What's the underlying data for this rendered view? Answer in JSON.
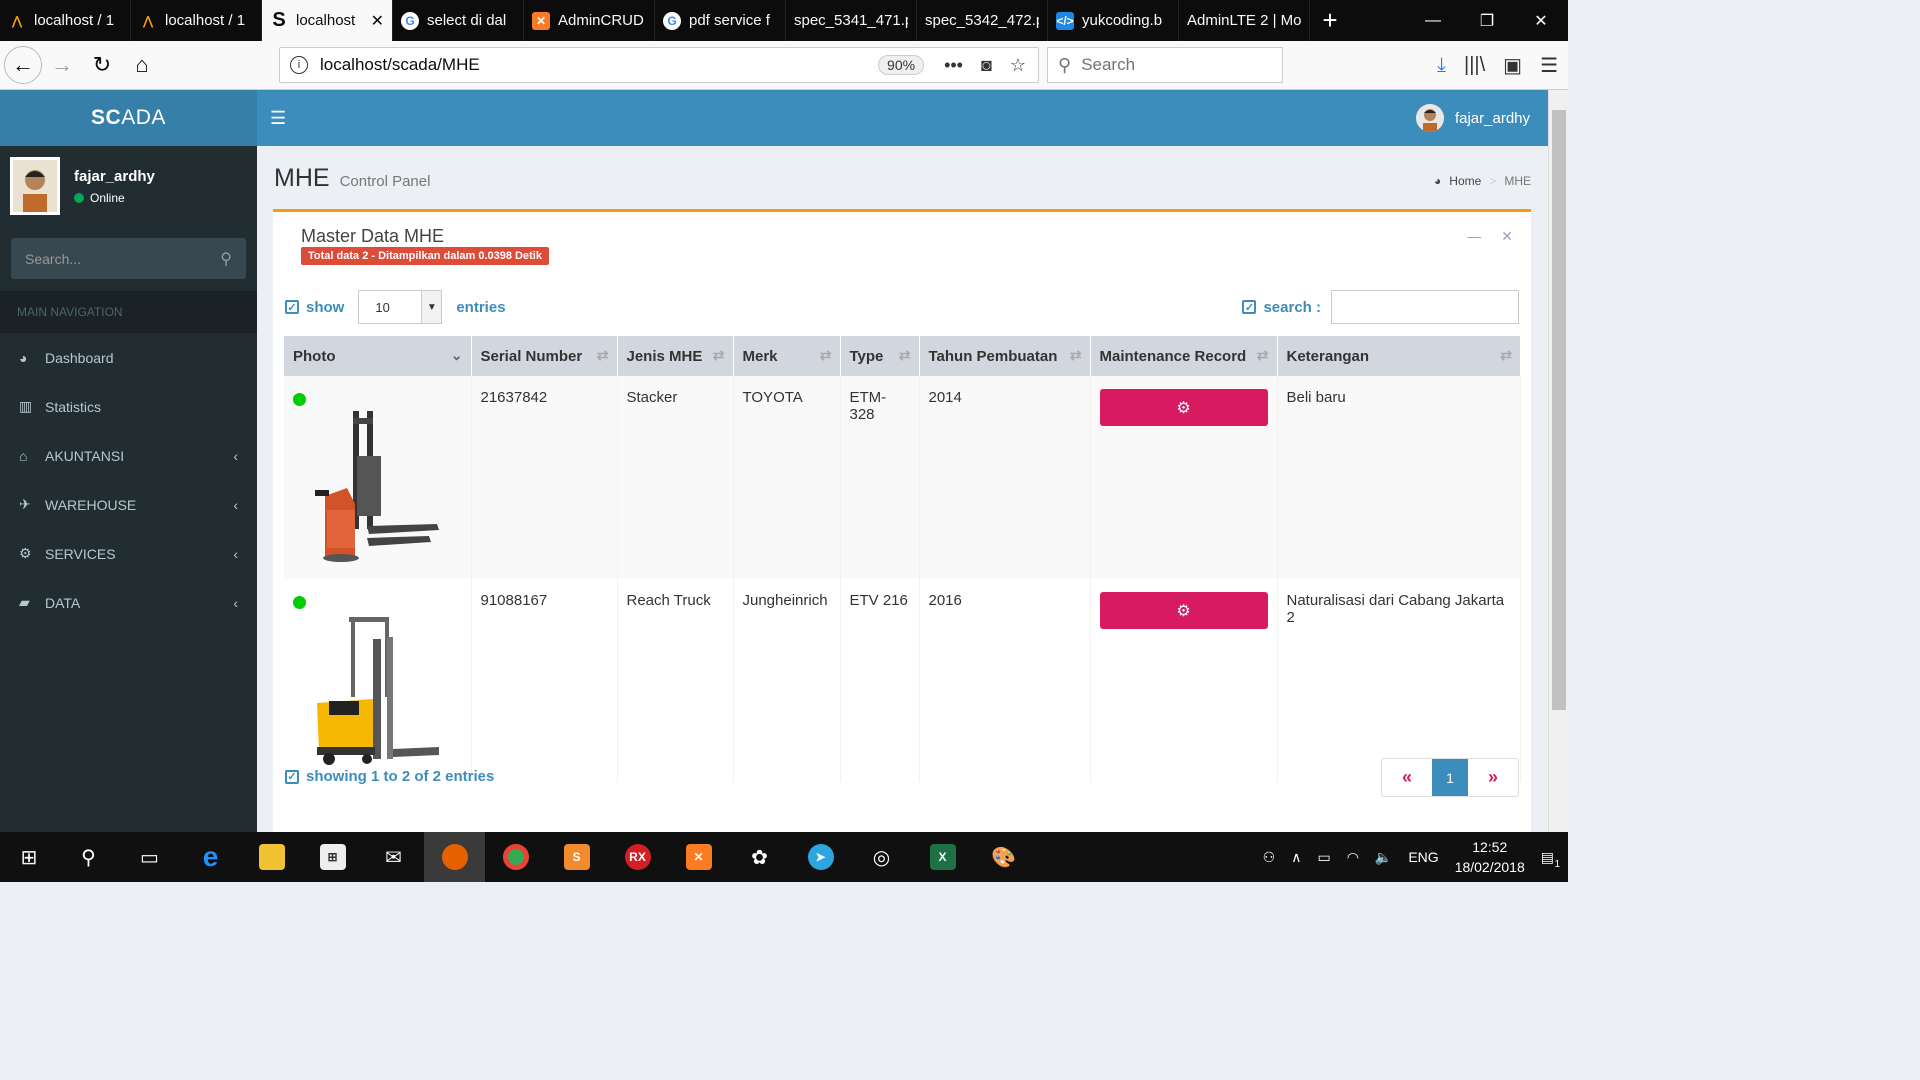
{
  "browser": {
    "tabs": [
      {
        "label": "localhost / 1",
        "icon": "phpmyadmin-icon",
        "active": false
      },
      {
        "label": "localhost / 1",
        "icon": "phpmyadmin-icon",
        "active": false
      },
      {
        "label": "localhost",
        "icon": "s-logo-icon",
        "active": true
      },
      {
        "label": "select di dal",
        "icon": "google-icon",
        "active": false
      },
      {
        "label": "AdminCRUD",
        "icon": "xampp-icon",
        "active": false
      },
      {
        "label": "pdf service f",
        "icon": "google-icon",
        "active": false
      },
      {
        "label": "spec_5341_471.p",
        "icon": "none",
        "active": false
      },
      {
        "label": "spec_5342_472.p",
        "icon": "none",
        "active": false
      },
      {
        "label": "yukcoding.b",
        "icon": "code-icon",
        "active": false
      },
      {
        "label": "AdminLTE 2 | Mo",
        "icon": "none",
        "active": false
      }
    ],
    "url": "localhost/scada/MHE",
    "zoom": "90%",
    "search_placeholder": "Search"
  },
  "header": {
    "logo_bold": "SC",
    "logo_mid": "A",
    "logo_rest": "DA",
    "username": "fajar_ardhy"
  },
  "sidebar": {
    "username": "fajar_ardhy",
    "status": "Online",
    "search_placeholder": "Search...",
    "section": "MAIN NAVIGATION",
    "items": [
      {
        "label": "Dashboard",
        "icon": "dashboard-icon",
        "has_children": false
      },
      {
        "label": "Statistics",
        "icon": "bar-chart-icon",
        "has_children": false
      },
      {
        "label": "AKUNTANSI",
        "icon": "bank-icon",
        "has_children": true
      },
      {
        "label": "WAREHOUSE",
        "icon": "plane-icon",
        "has_children": true
      },
      {
        "label": "SERVICES",
        "icon": "gears-icon",
        "has_children": true
      },
      {
        "label": "DATA",
        "icon": "folder-open-icon",
        "has_children": true
      }
    ]
  },
  "content": {
    "title": "MHE",
    "subtitle": "Control Panel",
    "breadcrumb": [
      "Home",
      "MHE"
    ]
  },
  "box": {
    "title": "Master Data MHE",
    "badge": "Total data 2 - Ditampilkan dalam 0.0398 Detik",
    "show_label": "show",
    "show_value": "10",
    "entries_label": "entries",
    "search_label": "search :",
    "columns": [
      "Photo",
      "Serial Number",
      "Jenis MHE",
      "Merk",
      "Type",
      "Tahun Pembuatan",
      "Maintenance Record",
      "Keterangan"
    ],
    "rows": [
      {
        "status_color": "#00cc00",
        "serial": "21637842",
        "jenis": "Stacker",
        "merk": "TOYOTA",
        "type": "ETM-328",
        "tahun": "2014",
        "keterangan": "Beli baru"
      },
      {
        "status_color": "#00cc00",
        "serial": "91088167",
        "jenis": "Reach Truck",
        "merk": "Jungheinrich",
        "type": "ETV 216",
        "tahun": "2016",
        "keterangan": "Naturalisasi dari Cabang Jakarta 2"
      }
    ],
    "showing": "showing 1 to 2 of 2 entries",
    "pager": {
      "prev": "«",
      "current": "1",
      "next": "»"
    }
  },
  "taskbar": {
    "lang": "ENG",
    "time": "12:52",
    "date": "18/02/2018",
    "notif_count": "1"
  },
  "colors": {
    "header": "#3c8dbc",
    "sidebar": "#222d32",
    "accent_box": "#f39c12",
    "badge": "#dd4b39",
    "maintenance_button": "#d81b60"
  }
}
